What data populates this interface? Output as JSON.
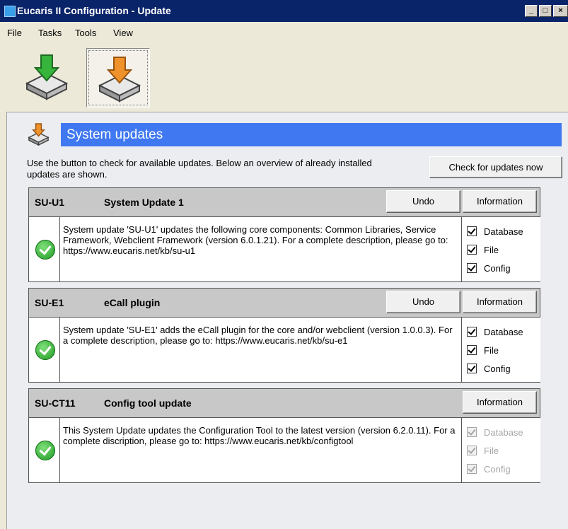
{
  "window": {
    "title": "Eucaris II Configuration - Update"
  },
  "menu": [
    "File",
    "Tasks",
    "Tools",
    "View"
  ],
  "toolbar": {
    "buttons": [
      {
        "icon": "download-green-icon"
      },
      {
        "icon": "download-orange-icon",
        "selected": true
      }
    ]
  },
  "section": {
    "title": "System updates",
    "intro": "Use the button to check for available updates. Below an overview of already installed updates are shown.",
    "check_button": "Check for updates now"
  },
  "updates": [
    {
      "code": "SU-U1",
      "name": "System Update 1",
      "undo": "Undo",
      "info": "Information",
      "description": "System update 'SU-U1' updates the following core components: Common Libraries, Service Framework, Webclient Framework (version 6.0.1.21). For a complete description, please go to: https://www.eucaris.net/kb/su-u1",
      "options": [
        "Database",
        "File",
        "Config"
      ]
    },
    {
      "code": "SU-E1",
      "name": "eCall plugin",
      "undo": "Undo",
      "info": "Information",
      "description": "System update 'SU-E1' adds the eCall plugin for the core and/or webclient (version 1.0.0.3). For a complete description, please go to: https://www.eucaris.net/kb/su-e1",
      "options": [
        "Database",
        "File",
        "Config"
      ]
    },
    {
      "code": "SU-CT11",
      "name": "Config tool update",
      "info": "Information",
      "description": "This System Update updates the Configuration Tool to the latest version (version 6.2.0.11). For a complete discription, please go to: https://www.eucaris.net/kb/configtool",
      "options": [
        "Database",
        "File",
        "Config"
      ]
    }
  ],
  "colors": {
    "titlebar": "#0a246a",
    "banner": "#3f78f0",
    "header_row": "#c8c8c8"
  }
}
